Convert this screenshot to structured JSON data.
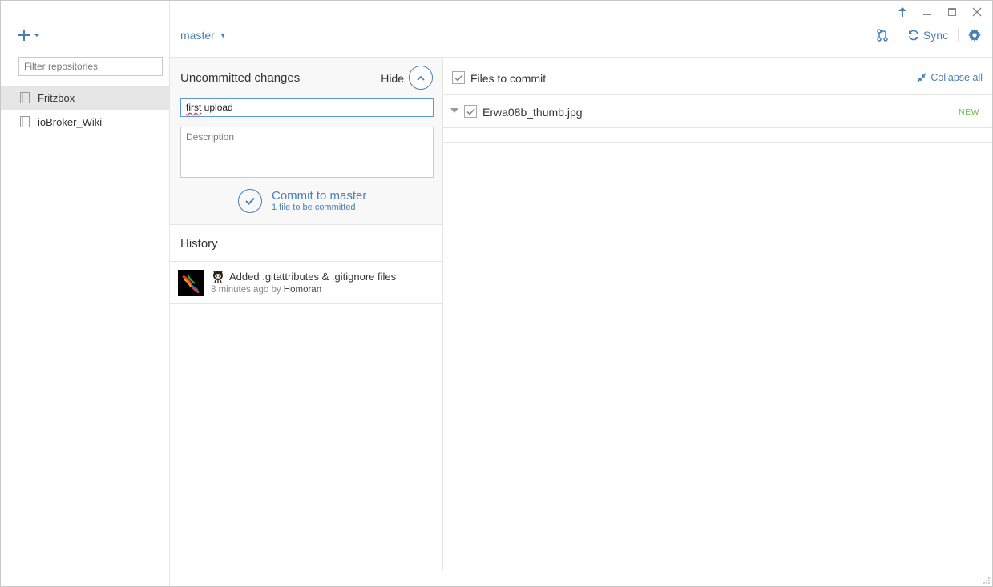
{
  "sidebar": {
    "filter_placeholder": "Filter repositories",
    "repos": [
      {
        "label": "Fritzbox",
        "selected": true
      },
      {
        "label": "ioBroker_Wiki",
        "selected": false
      }
    ]
  },
  "topbar": {
    "branch": "master",
    "sync_label": "Sync"
  },
  "changes": {
    "title": "Uncommitted changes",
    "hide_label": "Hide",
    "summary_value": "first upload",
    "summary_misspelled_word": "first",
    "summary_rest": " upload",
    "description_placeholder": "Description",
    "commit_label": "Commit to master",
    "commit_sub": "1 file to be committed"
  },
  "history": {
    "title": "History",
    "items": [
      {
        "message": "Added .gitattributes & .gitignore files",
        "time": "8 minutes ago",
        "by": " by ",
        "author": "Homoran"
      }
    ]
  },
  "files": {
    "header": "Files to commit",
    "collapse_label": "Collapse all",
    "items": [
      {
        "name": "Erwa08b_thumb.jpg",
        "status": "NEW"
      }
    ]
  },
  "colors": {
    "accent": "#4a7fb5",
    "new_badge": "#6cbb4a",
    "selected_row": "#e6e6e6"
  }
}
